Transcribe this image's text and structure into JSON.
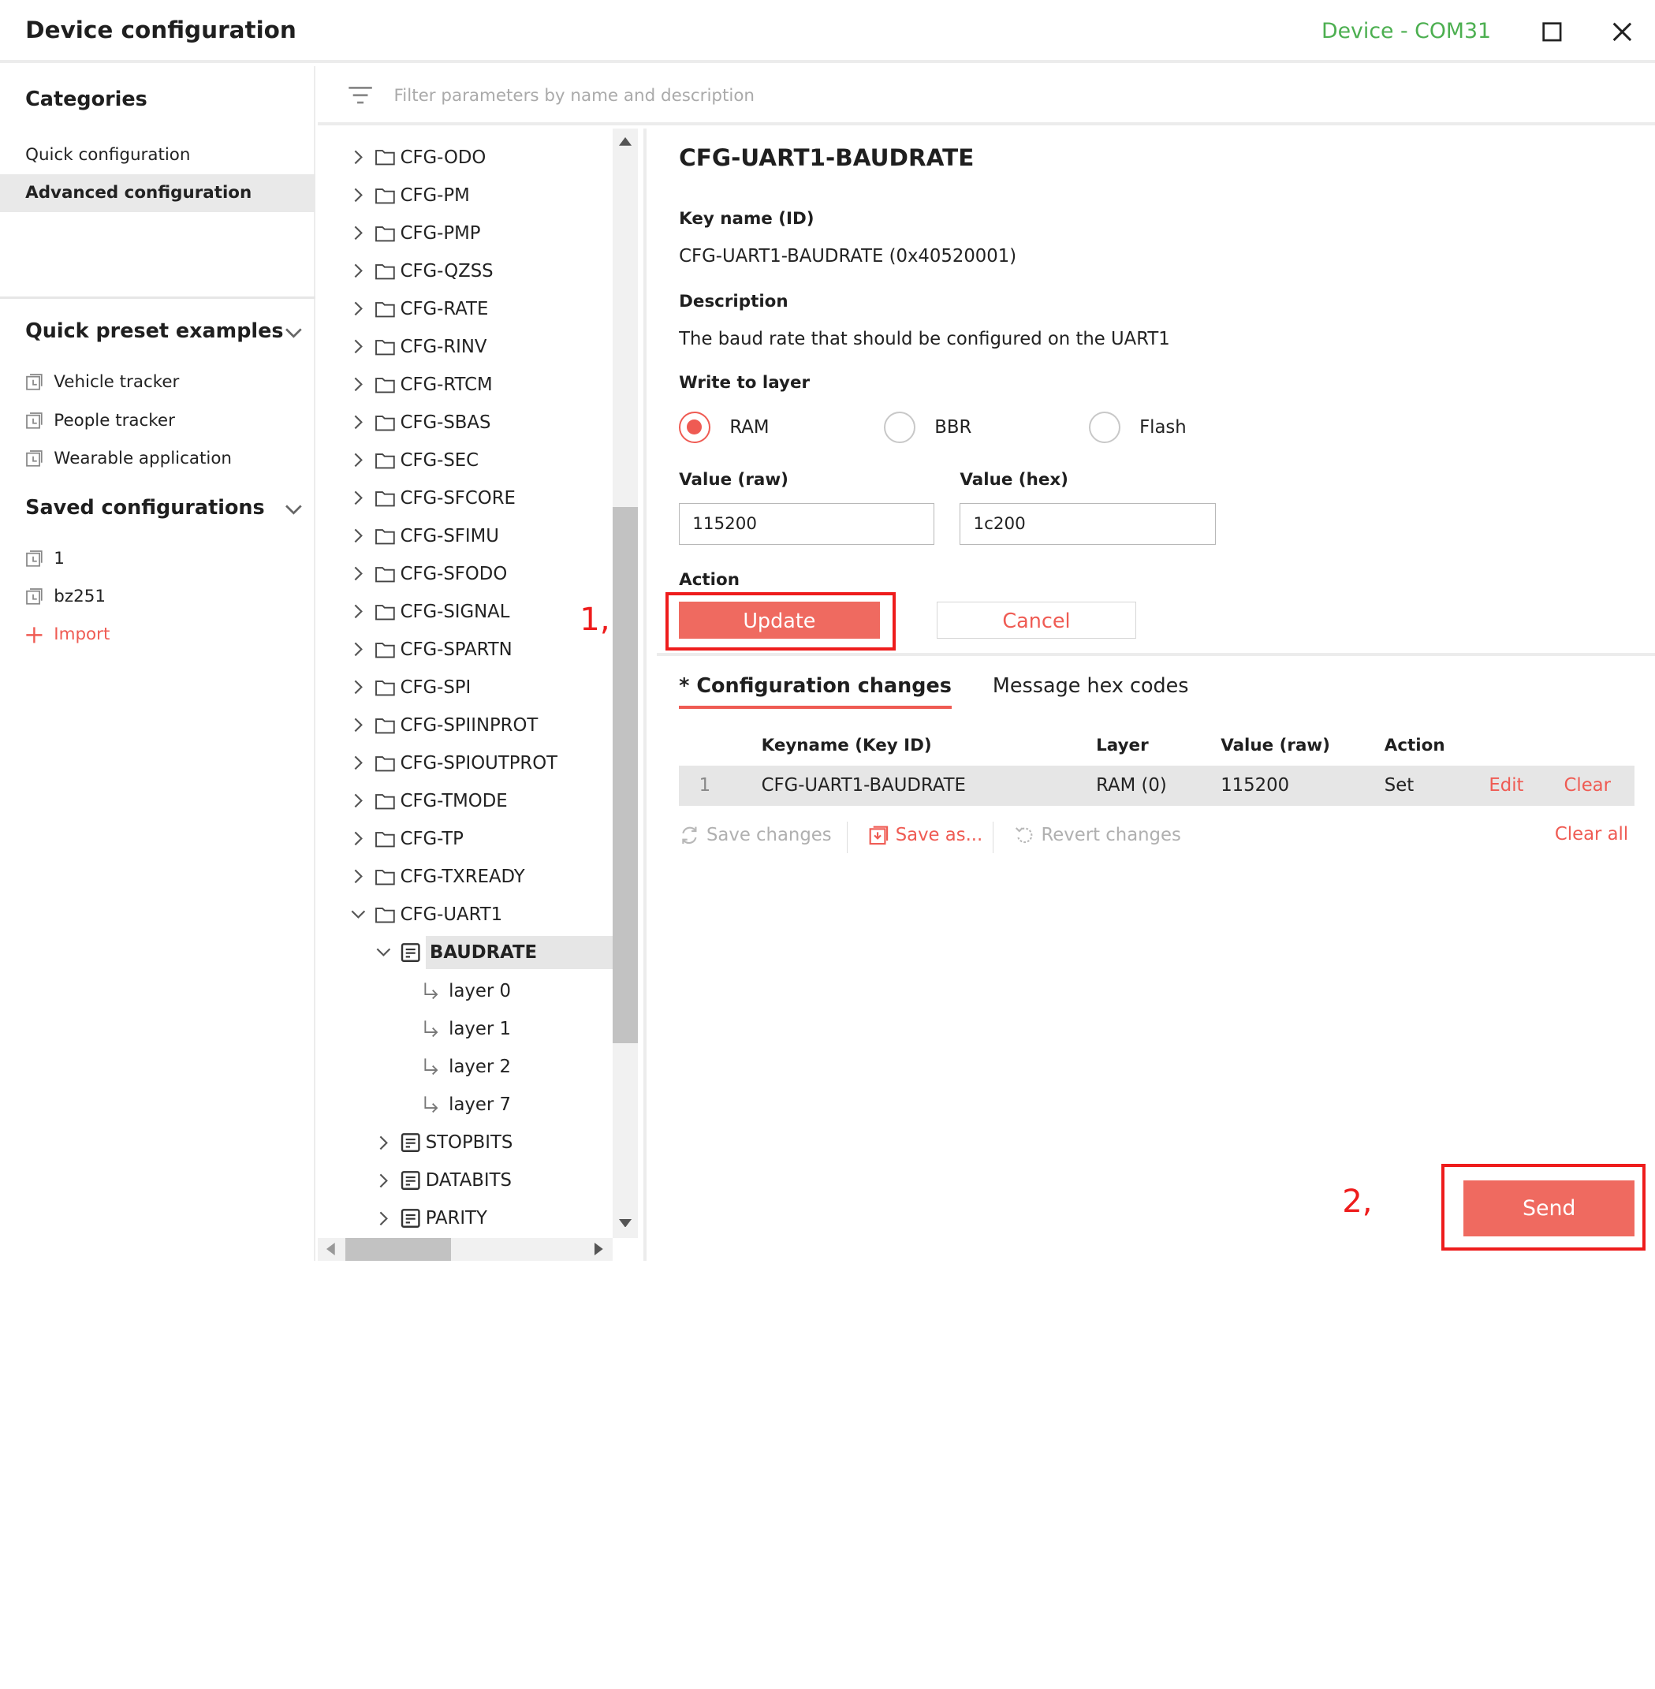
{
  "window": {
    "title": "Device configuration",
    "device_label": "Device - COM31",
    "device_label_color": "#4caf50",
    "controls": [
      "maximize-icon",
      "close-icon"
    ]
  },
  "sidebar": {
    "categories_title": "Categories",
    "categories": [
      {
        "label": "Quick configuration",
        "active": false
      },
      {
        "label": "Advanced configuration",
        "active": true
      }
    ],
    "presets_title": "Quick preset examples",
    "presets": [
      "Vehicle tracker",
      "People tracker",
      "Wearable application"
    ],
    "saved_title": "Saved configurations",
    "saved": [
      "1",
      "bz251"
    ],
    "import_label": "Import"
  },
  "filter": {
    "placeholder": "Filter parameters by name and description",
    "value": ""
  },
  "tree": {
    "groups": [
      "CFG-ODO",
      "CFG-PM",
      "CFG-PMP",
      "CFG-QZSS",
      "CFG-RATE",
      "CFG-RINV",
      "CFG-RTCM",
      "CFG-SBAS",
      "CFG-SEC",
      "CFG-SFCORE",
      "CFG-SFIMU",
      "CFG-SFODO",
      "CFG-SIGNAL",
      "CFG-SPARTN",
      "CFG-SPI",
      "CFG-SPIINPROT",
      "CFG-SPIOUTPROT",
      "CFG-TMODE",
      "CFG-TP",
      "CFG-TXREADY"
    ],
    "expanded_group": "CFG-UART1",
    "selected_param": "BAUDRATE",
    "layers": [
      "layer 0",
      "layer 1",
      "layer 2",
      "layer 7"
    ],
    "more_params": [
      "STOPBITS",
      "DATABITS",
      "PARITY"
    ]
  },
  "details": {
    "param_name": "CFG-UART1-BAUDRATE",
    "key_label": "Key name (ID)",
    "key_value": "CFG-UART1-BAUDRATE (0x40520001)",
    "desc_label": "Description",
    "desc_value": "The baud rate that should be configured on the UART1",
    "layer_label": "Write to layer",
    "layers": [
      {
        "label": "RAM",
        "checked": true
      },
      {
        "label": "BBR",
        "checked": false
      },
      {
        "label": "Flash",
        "checked": false
      }
    ],
    "raw_label": "Value (raw)",
    "raw_value": "115200",
    "hex_label": "Value (hex)",
    "hex_value": "1c200",
    "action_label": "Action",
    "update_label": "Update",
    "cancel_label": "Cancel"
  },
  "changes": {
    "tab_active": "* Configuration changes",
    "tab_other": "Message hex codes",
    "columns": [
      "Keyname (Key ID)",
      "Layer",
      "Value (raw)",
      "Action"
    ],
    "rows": [
      {
        "index": "1",
        "keyname": "CFG-UART1-BAUDRATE",
        "layer": "RAM (0)",
        "value": "115200",
        "action": "Set",
        "edit": "Edit",
        "clear": "Clear"
      }
    ],
    "save_changes": "Save changes",
    "save_as": "Save as...",
    "revert_changes": "Revert changes",
    "clear_all": "Clear all",
    "send_label": "Send"
  },
  "annotations": {
    "step1": "1,",
    "step2": "2,"
  },
  "colors": {
    "accent": "#ef5b53",
    "button": "#ef6a60",
    "annotation": "#ee1c1c"
  }
}
